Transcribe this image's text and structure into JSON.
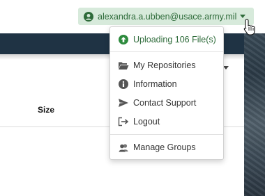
{
  "user": {
    "email": "alexandra.a.ubben@usace.army.mil",
    "icon": "user-circle-icon"
  },
  "table": {
    "size_header": "Size"
  },
  "menu": {
    "items": [
      {
        "label": "Uploading 106 File(s)",
        "icon": "upload-circle-icon"
      },
      {
        "label": "My Repositories",
        "icon": "folder-open-icon"
      },
      {
        "label": "Information",
        "icon": "info-circle-icon"
      },
      {
        "label": "Contact Support",
        "icon": "send-icon"
      },
      {
        "label": "Logout",
        "icon": "sign-out-icon"
      },
      {
        "label": "Manage Groups",
        "icon": "users-icon"
      }
    ]
  },
  "colors": {
    "accent_green": "#2e6b3a",
    "pill_bg": "#d7eadb",
    "navbar": "#1f3344"
  }
}
